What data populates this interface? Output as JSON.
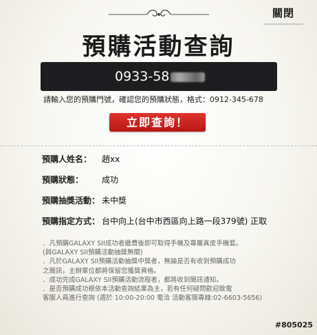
{
  "header": {
    "close_label": "關閉",
    "title": "預購活動查詢"
  },
  "search": {
    "phone_value": "0933-58",
    "hint": "請輸入您的預購門號，確認您的預購狀態，格式：0912-345-678",
    "button_label": "立即查詢！"
  },
  "result": {
    "rows": [
      {
        "label": "預購人姓名：",
        "value": "趙xx"
      },
      {
        "label": "預購狀態：",
        "value": "成功"
      },
      {
        "label": "預購抽獎活動：",
        "value": "未中獎"
      },
      {
        "label": "預購指定方式：",
        "value": "台中向上(台中市西區向上路一段379號) 正取"
      }
    ]
  },
  "notes": [
    "．凡預購GALAXY SII成功者繳費後即可取得手機及專屬真皮手機套。",
    "(與GALAXY SII預購活動抽獎無關)",
    "．凡於GALAXY SII預購活動抽獎中獎者，無論是否有收到預購成功",
    "之簡訊，主辦單位都將保留您獲獎資格。",
    "．成功完成GALAXY SII預購活動流程者，都將收到簡訊通知。",
    "．是否預購成功根依本活動查詢結果為主，若有任何疑問歡迎致電",
    "客服人員進行查詢 (週於 10:00-20:00 電洽 活動客服專線:02-6603-5656)"
  ],
  "watermark": "#805025"
}
